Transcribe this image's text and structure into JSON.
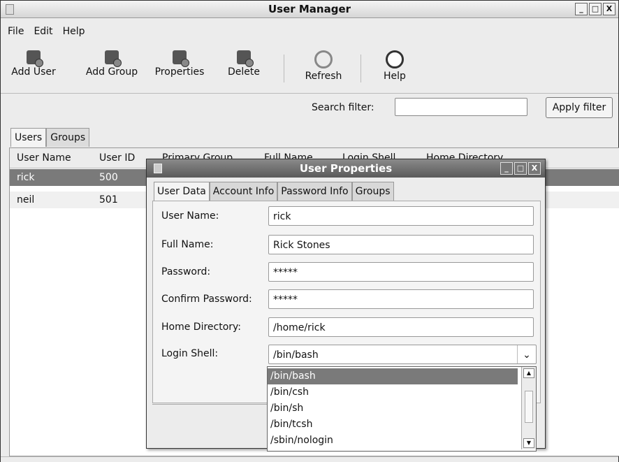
{
  "window": {
    "title": "User Manager",
    "min": "_",
    "max": "□",
    "close": "X"
  },
  "menubar": {
    "file": "File",
    "edit": "Edit",
    "help": "Help"
  },
  "toolbar": {
    "add_user": "Add User",
    "add_group": "Add Group",
    "properties": "Properties",
    "delete": "Delete",
    "refresh": "Refresh",
    "help": "Help"
  },
  "search": {
    "label": "Search filter:",
    "value": "",
    "apply": "Apply filter"
  },
  "main_tabs": {
    "users": "Users",
    "groups": "Groups"
  },
  "columns": {
    "user_name": "User Name",
    "user_id": "User ID",
    "primary_group": "Primary Group",
    "full_name": "Full Name",
    "login_shell": "Login Shell",
    "home_directory": "Home Directory"
  },
  "users": [
    {
      "name": "rick",
      "id": "500"
    },
    {
      "name": "neil",
      "id": "501"
    }
  ],
  "dialog": {
    "title": "User Properties",
    "tabs": {
      "user_data": "User Data",
      "account_info": "Account Info",
      "password_info": "Password Info",
      "groups": "Groups"
    },
    "fields": {
      "user_name_label": "User Name:",
      "user_name_value": "rick",
      "full_name_label": "Full Name:",
      "full_name_value": "Rick Stones",
      "password_label": "Password:",
      "password_value": "*****",
      "confirm_label": "Confirm Password:",
      "confirm_value": "*****",
      "home_label": "Home Directory:",
      "home_value": "/home/rick",
      "shell_label": "Login Shell:",
      "shell_value": "/bin/bash"
    },
    "shell_options": [
      "/bin/bash",
      "/bin/csh",
      "/bin/sh",
      "/bin/tcsh",
      "/sbin/nologin"
    ]
  }
}
